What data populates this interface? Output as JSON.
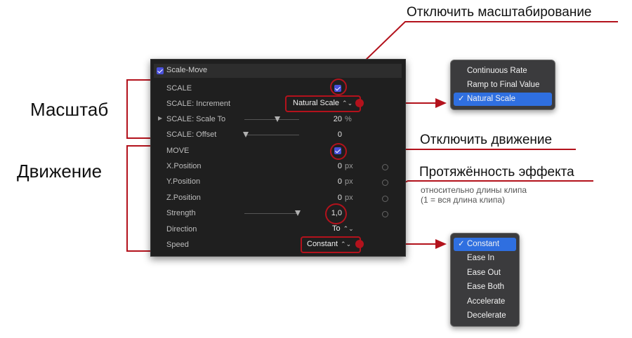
{
  "panel": {
    "title": "Scale-Move",
    "rows": {
      "scale": "SCALE",
      "scale_increment": "SCALE: Increment",
      "scale_increment_value": "Natural Scale",
      "scale_to": "SCALE: Scale To",
      "scale_to_value": "20",
      "scale_to_unit": "%",
      "scale_offset": "SCALE: Offset",
      "scale_offset_value": "0",
      "move": "MOVE",
      "x_position": "X.Position",
      "x_value": "0",
      "y_position": "Y.Position",
      "y_value": "0",
      "z_position": "Z.Position",
      "z_value": "0",
      "pos_unit": "px",
      "strength": "Strength",
      "strength_value": "1,0",
      "direction": "Direction",
      "direction_value": "To",
      "speed": "Speed",
      "speed_value": "Constant"
    }
  },
  "annotations": {
    "disable_scale": "Отключить масштабирование",
    "disable_move": "Отключить движение",
    "duration": "Протяжённость эффекта",
    "duration_note_1": "относительно длины клипа",
    "duration_note_2": "(1 = вся длина клипа)",
    "group_scale": "Масштаб",
    "group_move": "Движение"
  },
  "increment_menu": {
    "items": [
      "Continuous Rate",
      "Ramp to Final Value",
      "Natural Scale"
    ],
    "selected": "Natural Scale"
  },
  "speed_menu": {
    "items": [
      "Constant",
      "Ease In",
      "Ease Out",
      "Ease Both",
      "Accelerate",
      "Decelerate"
    ],
    "selected": "Constant"
  },
  "icons": [
    "checkbox-icon",
    "disclosure-triangle-icon",
    "slider-thumb-icon",
    "keyframe-icon",
    "checkmark-icon",
    "stepper-arrows-icon"
  ],
  "colors": {
    "accent": "#4a51dc",
    "annotation": "#b3121c",
    "selection": "#2f6fe0"
  }
}
